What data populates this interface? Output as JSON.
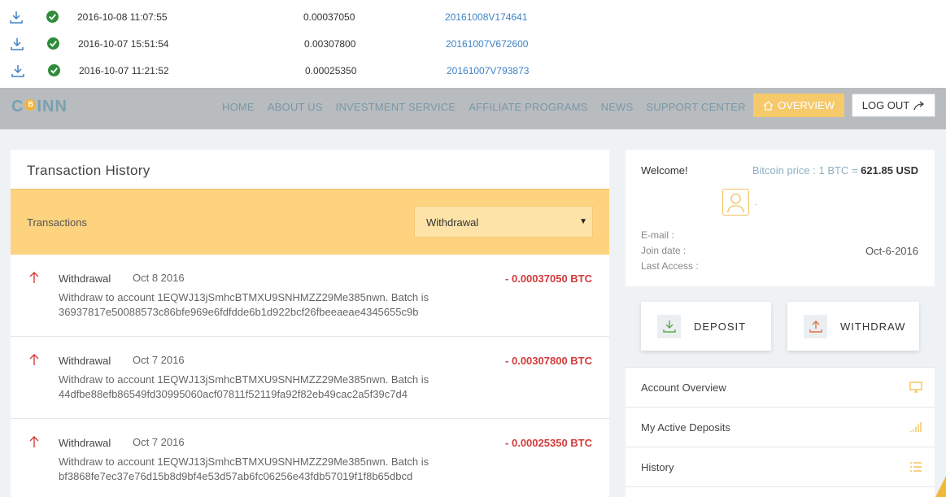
{
  "receipts": [
    {
      "datetime": "2016-10-08 11:07:55",
      "amount": "0.00037050",
      "batch": "20161008V174641"
    },
    {
      "datetime": "2016-10-07 15:51:54",
      "amount": "0.00307800",
      "batch": "20161007V672600"
    },
    {
      "datetime": "2016-10-07 11:21:52",
      "amount": "0.00025350",
      "batch": "20161007V793873"
    }
  ],
  "nav": {
    "logo": [
      "C",
      "INN"
    ],
    "links": [
      "HOME",
      "ABOUT US",
      "INVESTMENT SERVICE",
      "AFFILIATE PROGRAMS",
      "NEWS",
      "SUPPORT CENTER"
    ],
    "overview_label": "OVERVIEW",
    "logout_label": "LOG OUT"
  },
  "history": {
    "title": "Transaction History",
    "filter_label": "Transactions",
    "filter_selected": "Withdrawal",
    "entries": [
      {
        "type": "Withdrawal",
        "date": "Oct 8 2016",
        "amount": "- 0.00037050 BTC",
        "desc": "Withdraw to account 1EQWJ13jSmhcBTMXU9SNHMZZ29Me385nwn. Batch is 36937817e50088573c86bfe969e6fdfdde6b1d922bcf26fbeeaeae4345655c9b"
      },
      {
        "type": "Withdrawal",
        "date": "Oct 7 2016",
        "amount": "- 0.00307800 BTC",
        "desc": "Withdraw to account 1EQWJ13jSmhcBTMXU9SNHMZZ29Me385nwn. Batch is 44dfbe88efb86549fd30995060acf07811f52119fa92f82eb49cac2a5f39c7d4"
      },
      {
        "type": "Withdrawal",
        "date": "Oct 7 2016",
        "amount": "- 0.00025350 BTC",
        "desc": "Withdraw to account 1EQWJ13jSmhcBTMXU9SNHMZZ29Me385nwn. Batch is bf3868fe7ec37e76d15b8d9bf4e53d57ab6fc06256e43fdb57019f1f8b65dbcd"
      }
    ]
  },
  "account": {
    "welcome": "Welcome!",
    "btc_price_label": "Bitcoin price : 1 BTC =",
    "btc_price_value": "621.85 USD",
    "dot": ".",
    "email_label": "E-mail :",
    "join_label": "Join date :",
    "join_value": "Oct-6-2016",
    "last_access_label": "Last Access :",
    "deposit_label": "DEPOSIT",
    "withdraw_label": "WITHDRAW"
  },
  "menu": [
    "Account Overview",
    "My Active Deposits",
    "History"
  ],
  "colors": {
    "accent": "#fdd37f",
    "negative": "#d33b3b",
    "link": "#3f82c4",
    "nav_bg": "#b8bcbf"
  }
}
